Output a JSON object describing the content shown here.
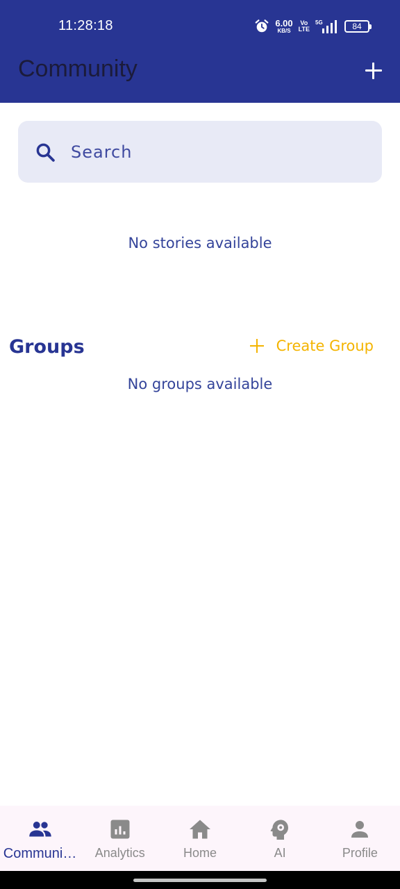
{
  "status_bar": {
    "time": "11:28:18",
    "net_speed_value": "6.00",
    "net_speed_unit": "KB/S",
    "volte_top": "Vo",
    "volte_bottom": "LTE",
    "network_type": "5G",
    "battery": "84"
  },
  "app_bar": {
    "title": "Community",
    "add_icon": "plus-icon"
  },
  "search": {
    "placeholder": "Search",
    "icon": "search-icon"
  },
  "stories": {
    "empty_text": "No stories available"
  },
  "groups": {
    "title": "Groups",
    "create_label": "Create Group",
    "empty_text": "No groups available"
  },
  "bottom_nav": {
    "items": [
      {
        "label": "Communi…",
        "icon": "people-icon",
        "active": true
      },
      {
        "label": "Analytics",
        "icon": "analytics-icon",
        "active": false
      },
      {
        "label": "Home",
        "icon": "home-icon",
        "active": false
      },
      {
        "label": "AI",
        "icon": "psychology-icon",
        "active": false
      },
      {
        "label": "Profile",
        "icon": "person-icon",
        "active": false
      }
    ]
  },
  "colors": {
    "primary": "#283593",
    "accent": "#f4b400",
    "search_bg": "#e8eaf6",
    "nav_bg": "#fdf5fb",
    "inactive": "#8a8a8a"
  }
}
